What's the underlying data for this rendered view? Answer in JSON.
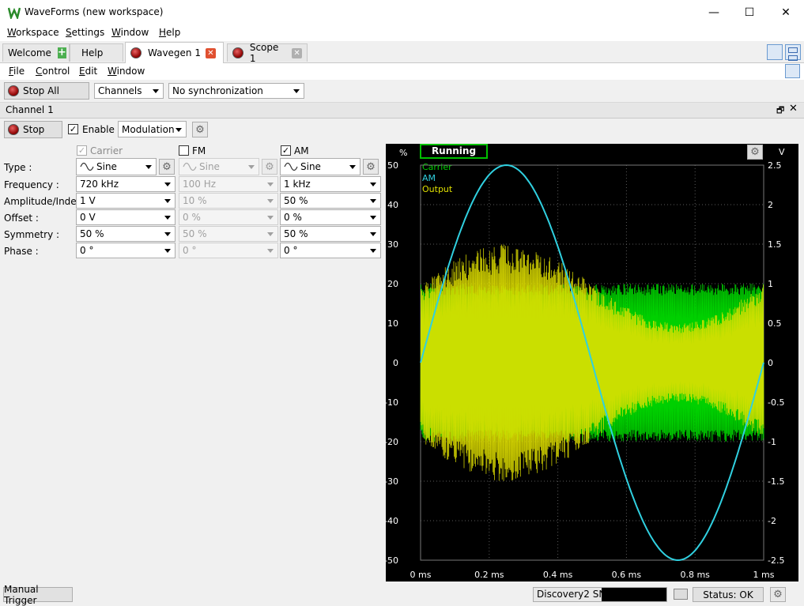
{
  "window": {
    "title": "WaveForms (new workspace)",
    "minimize": "—",
    "maximize": "☐",
    "close": "✕"
  },
  "menubar": {
    "items": [
      {
        "pre": "",
        "key": "W",
        "post": "orkspace"
      },
      {
        "pre": "",
        "key": "S",
        "post": "ettings"
      },
      {
        "pre": "",
        "key": "W",
        "post": "indow"
      },
      {
        "pre": "",
        "key": "H",
        "post": "elp"
      }
    ]
  },
  "tabs": [
    {
      "label": "Welcome"
    },
    {
      "label": "Help"
    },
    {
      "label": "Wavegen 1"
    },
    {
      "label": "Scope 1"
    }
  ],
  "wavegen_menu": {
    "items": [
      {
        "key": "F",
        "post": "ile"
      },
      {
        "key": "C",
        "post": "ontrol"
      },
      {
        "key": "E",
        "post": "dit"
      },
      {
        "key": "W",
        "post": "indow"
      }
    ]
  },
  "toolbar": {
    "stop_all": "Stop All",
    "channels": "Channels",
    "sync": "No synchronization"
  },
  "channel": {
    "title": "Channel 1",
    "stop": "Stop",
    "enable": "Enable",
    "mode": "Modulation"
  },
  "params": {
    "headers": {
      "carrier": "Carrier",
      "fm": "FM",
      "am": "AM"
    },
    "rows": [
      {
        "label": "Type :",
        "carrier": "Sine",
        "fm": "Sine",
        "am": "Sine"
      },
      {
        "label": "Frequency :",
        "carrier": "720 kHz",
        "fm": "100 Hz",
        "am": "1 kHz"
      },
      {
        "label": "Amplitude/Index :",
        "carrier": "1 V",
        "fm": "10 %",
        "am": "50 %"
      },
      {
        "label": "Offset :",
        "carrier": "0 V",
        "fm": "0 %",
        "am": "0 %"
      },
      {
        "label": "Symmetry :",
        "carrier": "50 %",
        "fm": "50 %",
        "am": "50 %"
      },
      {
        "label": "Phase :",
        "carrier": "0 °",
        "fm": "0 °",
        "am": "0 °"
      }
    ]
  },
  "plot": {
    "status": "Running",
    "left_unit": "%",
    "right_unit": "V",
    "legend": [
      {
        "name": "Carrier",
        "color": "#00d000"
      },
      {
        "name": "AM",
        "color": "#30d0e0"
      },
      {
        "name": "Output",
        "color": "#e0e000"
      }
    ]
  },
  "chart_data": {
    "type": "line",
    "xlabel_ticks": [
      "0 ms",
      "0.2 ms",
      "0.4 ms",
      "0.6 ms",
      "0.8 ms",
      "1 ms"
    ],
    "x_range_ms": [
      0,
      1
    ],
    "left_axis": {
      "unit": "%",
      "ticks": [
        "50",
        "40",
        "30",
        "20",
        "10",
        "0",
        "-10",
        "-20",
        "-30",
        "-40",
        "-50"
      ],
      "range": [
        -50,
        50
      ]
    },
    "right_axis": {
      "unit": "V",
      "ticks": [
        "2.5",
        "2",
        "1.5",
        "1",
        "0.5",
        "0",
        "-0.5",
        "-1",
        "-1.5",
        "-2",
        "-2.5"
      ],
      "range": [
        -2.5,
        2.5
      ]
    },
    "series": [
      {
        "name": "Carrier",
        "color": "#00d000",
        "amplitude_v": 1,
        "frequency_khz": 720
      },
      {
        "name": "AM",
        "color": "#30d0e0",
        "amplitude_pct": 50,
        "frequency_khz": 1
      },
      {
        "name": "Output",
        "color": "#e0e000",
        "amplitude_v": 1,
        "modulation_pct": 50
      }
    ],
    "grid": true
  },
  "statusbar": {
    "manual_trigger": "Manual Trigger",
    "device": "Discovery2 SN:",
    "status": "Status: OK"
  }
}
